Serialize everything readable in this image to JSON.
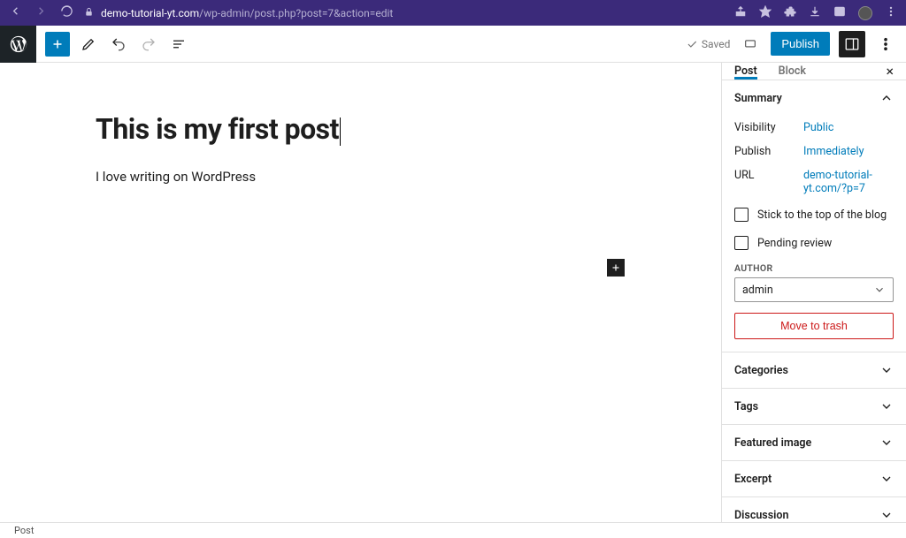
{
  "browser": {
    "url_host": "demo-tutorial-yt.com",
    "url_path": "/wp-admin/post.php?post=7&action=edit"
  },
  "toolbar": {
    "saved_label": "Saved",
    "publish_label": "Publish"
  },
  "post": {
    "title": "This is my first post",
    "body": "I love writing on WordPress"
  },
  "sidebar": {
    "tabs": {
      "post": "Post",
      "block": "Block"
    },
    "summary": {
      "title": "Summary",
      "visibility_label": "Visibility",
      "visibility_value": "Public",
      "publish_label": "Publish",
      "publish_value": "Immediately",
      "url_label": "URL",
      "url_value": "demo-tutorial-yt.com/?p=7",
      "sticky_label": "Stick to the top of the blog",
      "pending_label": "Pending review",
      "author_label": "Author",
      "author_value": "admin",
      "trash_label": "Move to trash"
    },
    "panels": {
      "categories": "Categories",
      "tags": "Tags",
      "featured_image": "Featured image",
      "excerpt": "Excerpt",
      "discussion": "Discussion"
    }
  },
  "status_bar": {
    "breadcrumb": "Post"
  }
}
